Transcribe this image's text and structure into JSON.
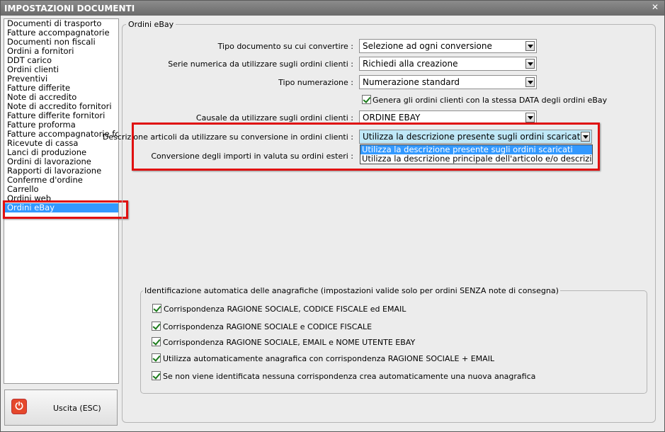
{
  "window": {
    "title": "IMPOSTAZIONI DOCUMENTI",
    "close_glyph": "✕"
  },
  "sidebar": {
    "items": [
      "Documenti di trasporto",
      "Fatture accompagnatorie",
      "Documenti non fiscali",
      "Ordini a fornitori",
      "DDT carico",
      "Ordini clienti",
      "Preventivi",
      "Fatture differite",
      "Note di accredito",
      "Note di accredito fornitori",
      "Fatture differite fornitori",
      "Fatture proforma",
      "Fatture accompagnatorie fc",
      "Ricevute di cassa",
      "Lanci di produzione",
      "Ordini di lavorazione",
      "Rapporti di lavorazione",
      "Conferme d'ordine",
      "Carrello",
      "Ordini web",
      "Ordini eBay"
    ],
    "selected": "Ordini eBay"
  },
  "exit_button": {
    "label": "Uscita (ESC)",
    "icon": "power-icon"
  },
  "group": {
    "title": "Ordini eBay"
  },
  "fields": {
    "tipo_documento": {
      "label": "Tipo documento su cui convertire :",
      "value": "Selezione ad ogni conversione"
    },
    "serie_numerica": {
      "label": "Serie numerica da utilizzare sugli ordini clienti :",
      "value": "Richiedi alla creazione"
    },
    "tipo_numerazione": {
      "label": "Tipo numerazione :",
      "value": "Numerazione standard"
    },
    "genera_data": {
      "label": "Genera gli ordini clienti con la stessa DATA degli ordini eBay",
      "checked": true
    },
    "causale": {
      "label": "Causale da utilizzare sugli ordini clienti :",
      "value": "ORDINE EBAY"
    },
    "descrizione_articoli": {
      "label": "Descrizione articoli da utilizzare su conversione in ordini clienti :",
      "value": "Utilizza la descrizione presente sugli ordini scaricati",
      "options": [
        "Utilizza la descrizione presente sugli ordini scaricati",
        "Utilizza la descrizione principale dell'articolo e/o descrizio"
      ]
    },
    "conversione_importi": {
      "label": "Conversione degli importi in valuta su ordini esteri :"
    }
  },
  "identificazione": {
    "title": "Identificazione automatica delle anagrafiche (impostazioni valide solo per ordini SENZA note di consegna)",
    "options": [
      {
        "label": "Corrispondenza RAGIONE SOCIALE, CODICE FISCALE ed EMAIL",
        "checked": true
      },
      {
        "label": "Corrispondenza RAGIONE SOCIALE e CODICE FISCALE",
        "checked": true
      },
      {
        "label": "Corrispondenza RAGIONE SOCIALE, EMAIL e NOME UTENTE EBAY",
        "checked": true
      },
      {
        "label": "Utilizza automaticamente anagrafica con corrispondenza RAGIONE SOCIALE + EMAIL",
        "checked": true
      },
      {
        "label": "Se non viene identificata nessuna corrispondenza crea automaticamente una nuova anagrafica",
        "checked": true
      }
    ]
  },
  "colors": {
    "highlight_box": "#e01010",
    "selection": "#3399ff"
  }
}
